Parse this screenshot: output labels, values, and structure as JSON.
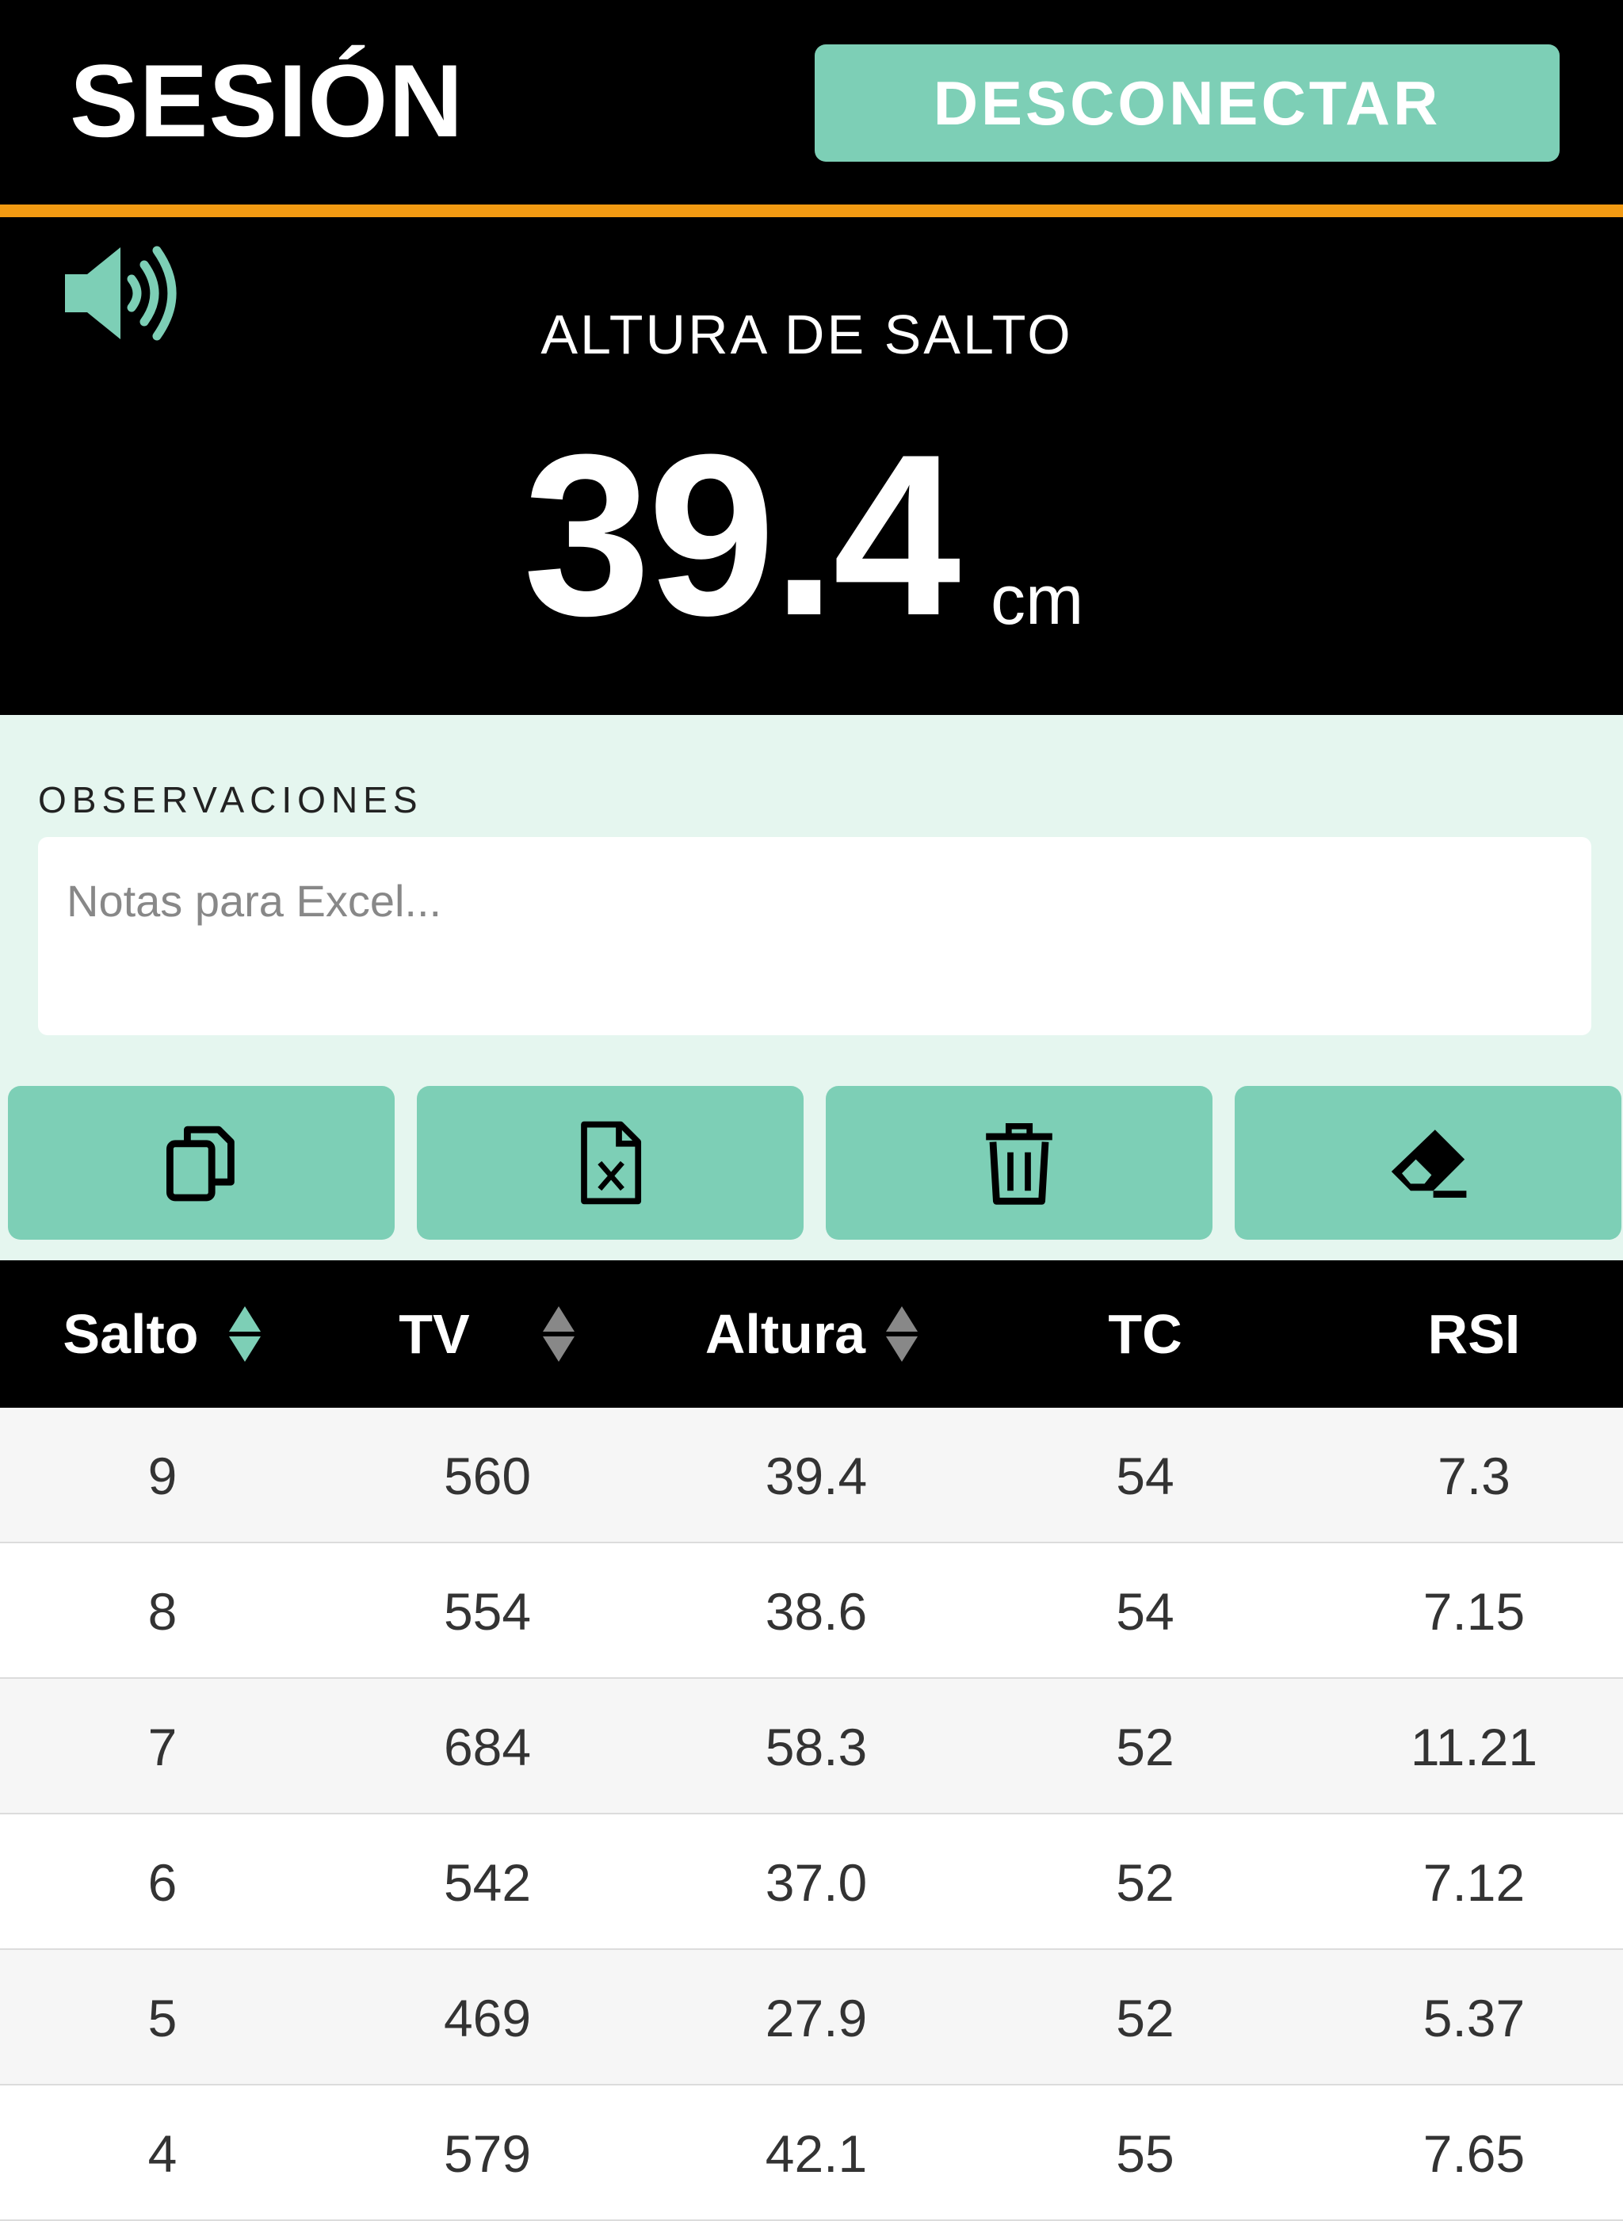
{
  "header": {
    "title": "SESIÓN",
    "disconnect_label": "DESCONECTAR",
    "accent_color": "#7dcfb6",
    "divider_color": "#f29a12"
  },
  "metric": {
    "sound_icon": "speaker-volume-icon",
    "label": "ALTURA DE SALTO",
    "value": "39.4",
    "unit": "cm"
  },
  "observations": {
    "label": "OBSERVACIONES",
    "placeholder": "Notas para Excel..."
  },
  "toolbar": [
    {
      "icon": "copy-icon"
    },
    {
      "icon": "excel-file-icon"
    },
    {
      "icon": "trash-icon"
    },
    {
      "icon": "eraser-icon"
    }
  ],
  "table": {
    "columns": [
      "Salto",
      "TV",
      "Altura",
      "TC",
      "RSI"
    ],
    "rows": [
      [
        "9",
        "560",
        "39.4",
        "54",
        "7.3"
      ],
      [
        "8",
        "554",
        "38.6",
        "54",
        "7.15"
      ],
      [
        "7",
        "684",
        "58.3",
        "52",
        "11.21"
      ],
      [
        "6",
        "542",
        "37.0",
        "52",
        "7.12"
      ],
      [
        "5",
        "469",
        "27.9",
        "52",
        "5.37"
      ],
      [
        "4",
        "579",
        "42.1",
        "55",
        "7.65"
      ]
    ]
  }
}
